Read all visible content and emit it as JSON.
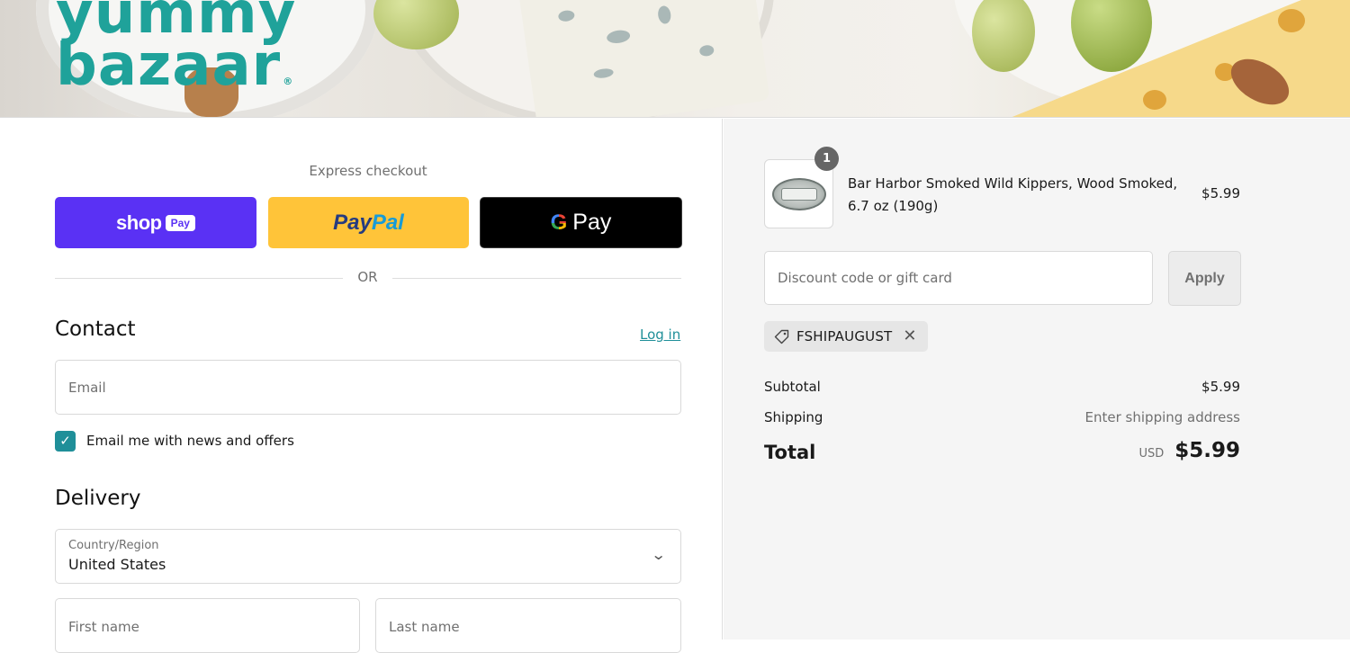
{
  "brand": {
    "line1": "yummy",
    "line2": "bazaar",
    "reg_mark": "®",
    "color": "#1fa29a"
  },
  "express": {
    "title": "Express checkout",
    "shop_pay": {
      "word": "shop",
      "badge": "Pay",
      "color": "#5a31f4"
    },
    "paypal": {
      "part1": "Pay",
      "part2": "Pal",
      "color": "#ffc439"
    },
    "gpay": {
      "g": "G",
      "word": "Pay",
      "color": "#000000"
    },
    "or_label": "OR"
  },
  "contact": {
    "title": "Contact",
    "login_link": "Log in",
    "email_placeholder": "Email",
    "newsletter_checked": true,
    "newsletter_label": "Email me with news and offers"
  },
  "delivery": {
    "title": "Delivery",
    "country_label": "Country/Region",
    "country_value": "United States",
    "first_name_placeholder": "First name",
    "last_name_placeholder": "Last name"
  },
  "order": {
    "item": {
      "quantity": "1",
      "name": "Bar Harbor Smoked Wild Kippers, Wood Smoked, 6.7 oz (190g)",
      "price": "$5.99"
    },
    "discount_placeholder": "Discount code or gift card",
    "apply_label": "Apply",
    "applied_code": "FSHIPAUGUST",
    "subtotal_label": "Subtotal",
    "subtotal_value": "$5.99",
    "shipping_label": "Shipping",
    "shipping_value": "Enter shipping address",
    "total_label": "Total",
    "currency": "USD",
    "total_value": "$5.99"
  },
  "colors": {
    "accent": "#1f8f99",
    "summary_bg": "#f5f5f5"
  },
  "icons": {
    "checkbox": "checkmark-icon",
    "country_select": "chevron-down-icon",
    "coupon": "tag-icon",
    "remove_code": "close-icon"
  }
}
